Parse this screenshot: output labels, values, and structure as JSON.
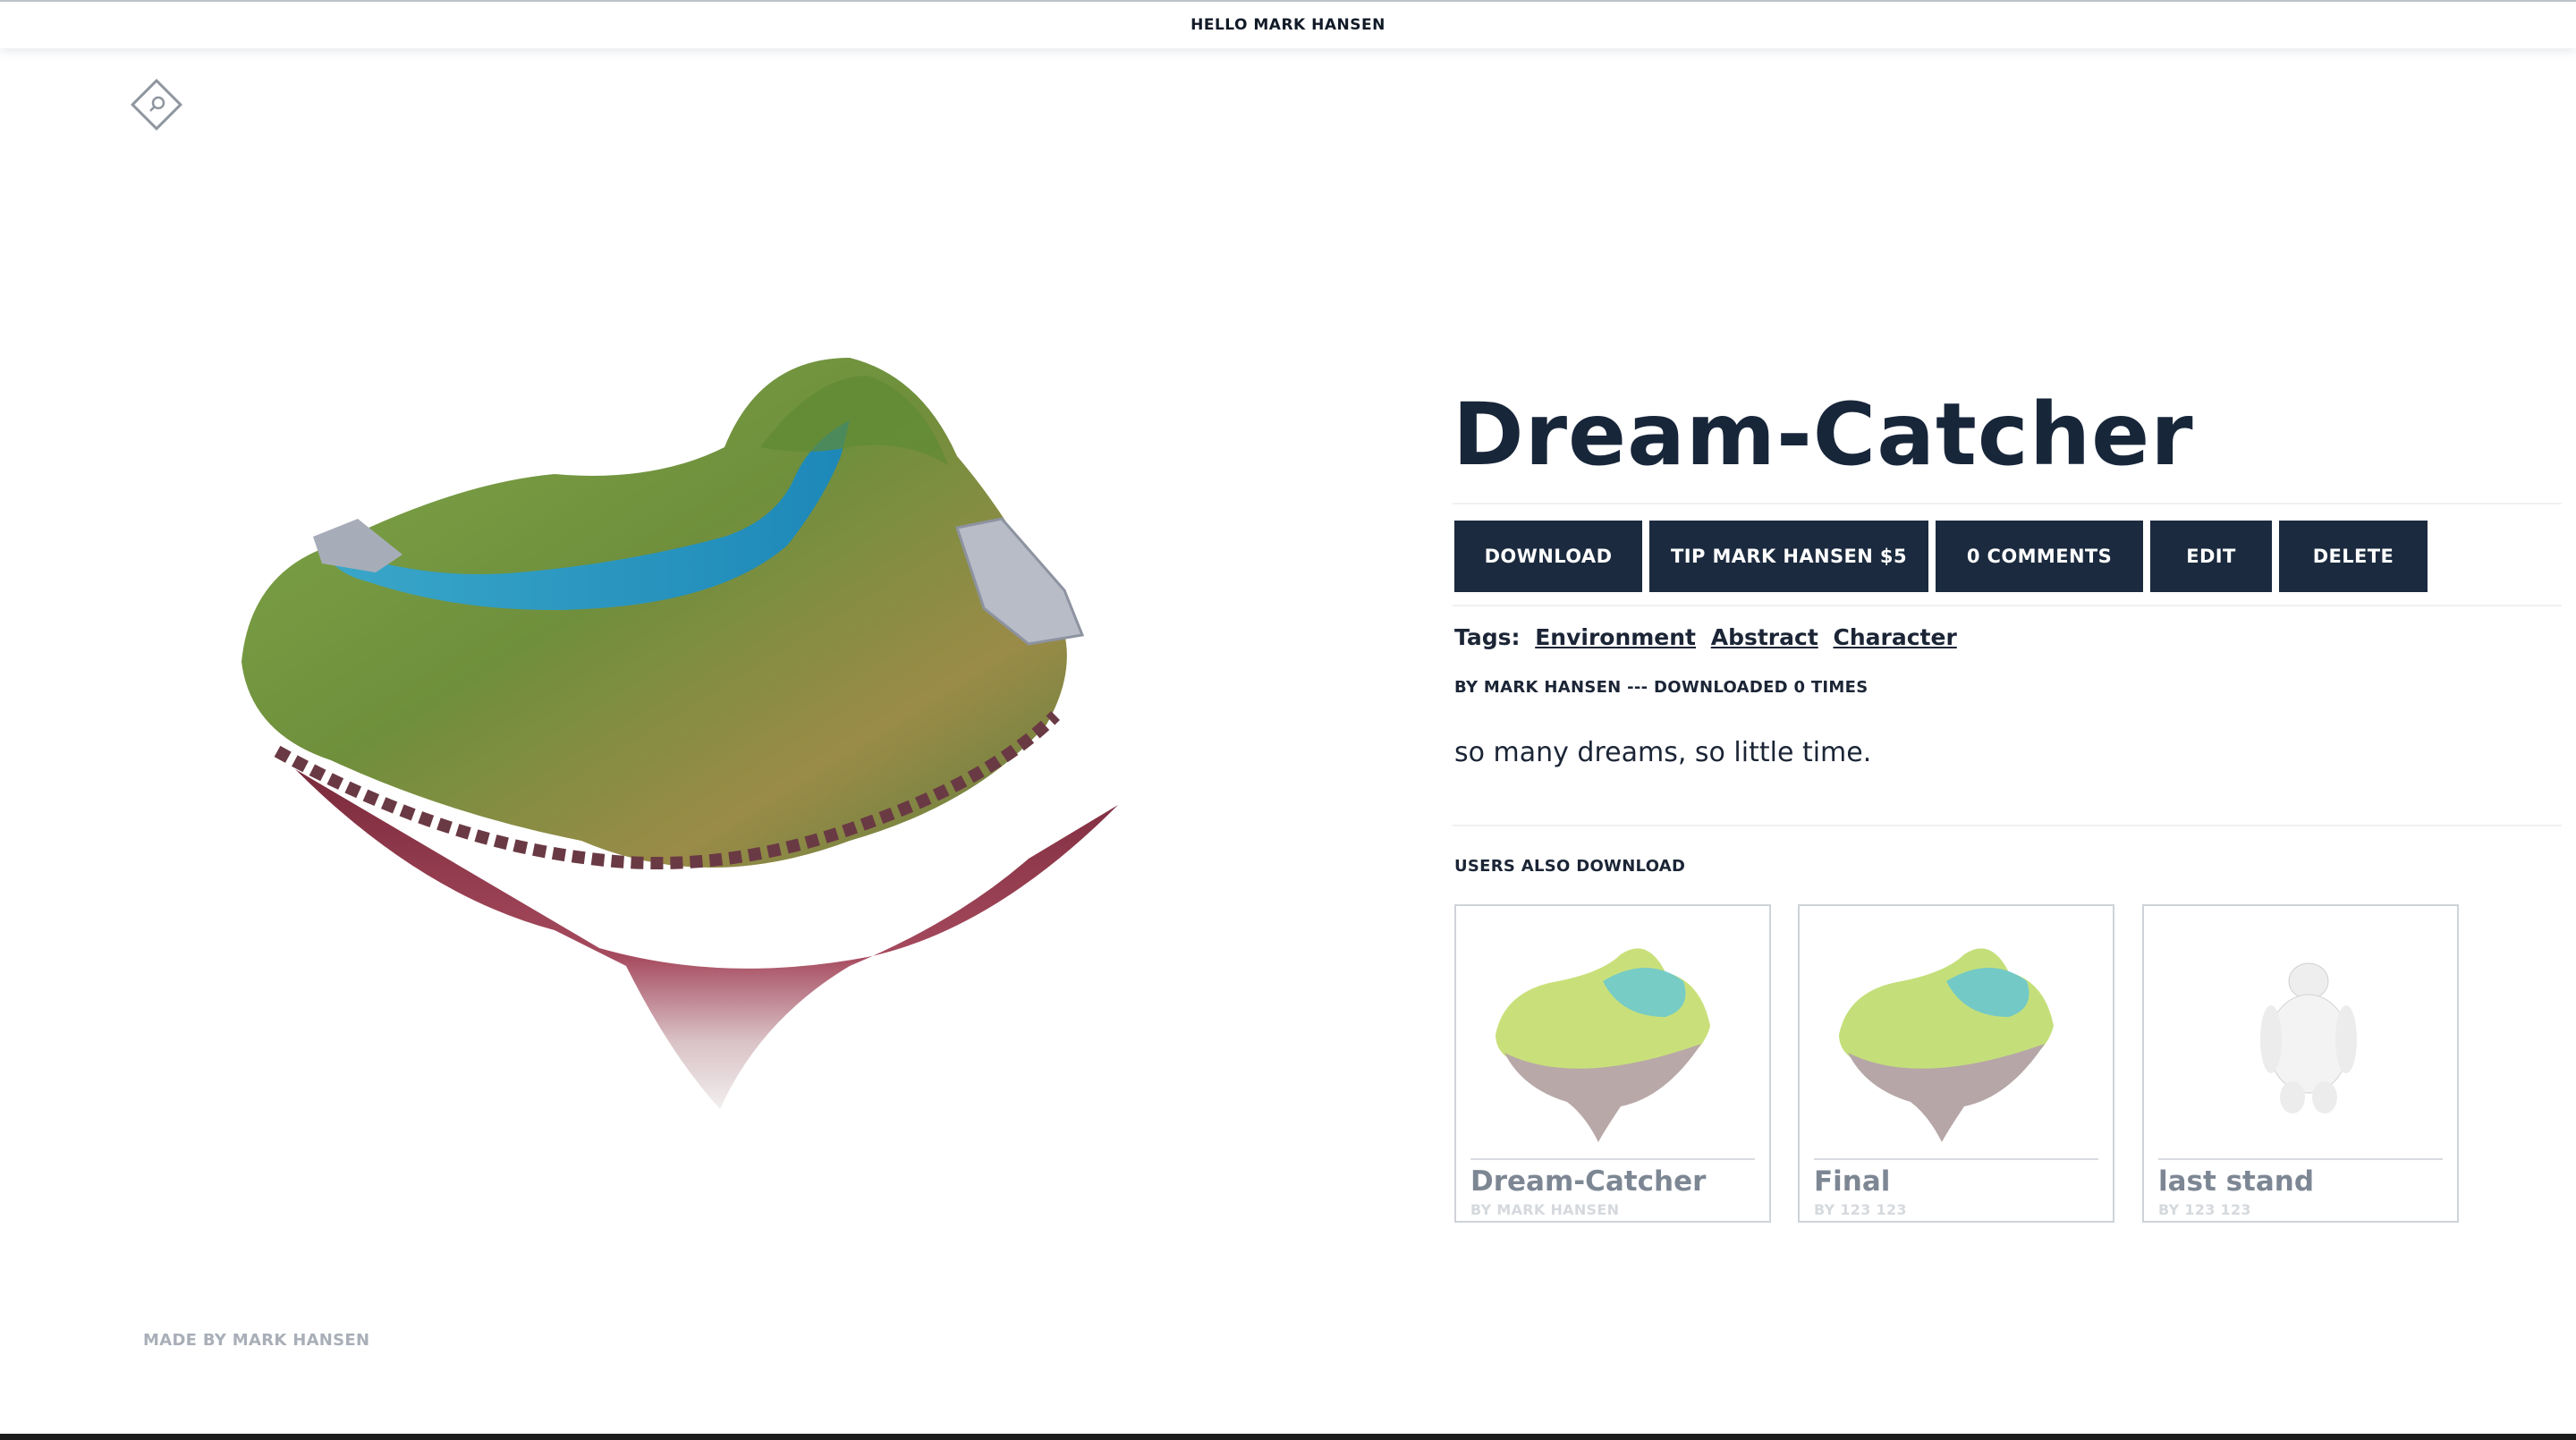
{
  "header": {
    "greeting": "HELLO MARK HANSEN"
  },
  "icons": {
    "logo": "search-diamond-icon"
  },
  "model": {
    "title": "Dream-Catcher",
    "actions": [
      {
        "label": "DOWNLOAD"
      },
      {
        "label": "TIP MARK HANSEN $5"
      },
      {
        "label": "0 COMMENTS"
      },
      {
        "label": "EDIT"
      },
      {
        "label": "DELETE"
      }
    ],
    "tags_label": "Tags:",
    "tags": [
      "Environment",
      "Abstract",
      "Character"
    ],
    "byline": "BY MARK HANSEN --- DOWNLOADED 0 TIMES",
    "description": "so many dreams, so little time."
  },
  "related": {
    "heading": "USERS ALSO DOWNLOAD",
    "items": [
      {
        "name": "Dream-Catcher",
        "by": "BY MARK HANSEN"
      },
      {
        "name": "Final",
        "by": "BY 123 123"
      },
      {
        "name": "last stand",
        "by": "BY 123 123"
      }
    ]
  },
  "footer": {
    "credit": "MADE BY MARK HANSEN"
  },
  "colors": {
    "accent": "#1b2a3e",
    "text": "#1b2536",
    "muted": "#a9afb8"
  }
}
